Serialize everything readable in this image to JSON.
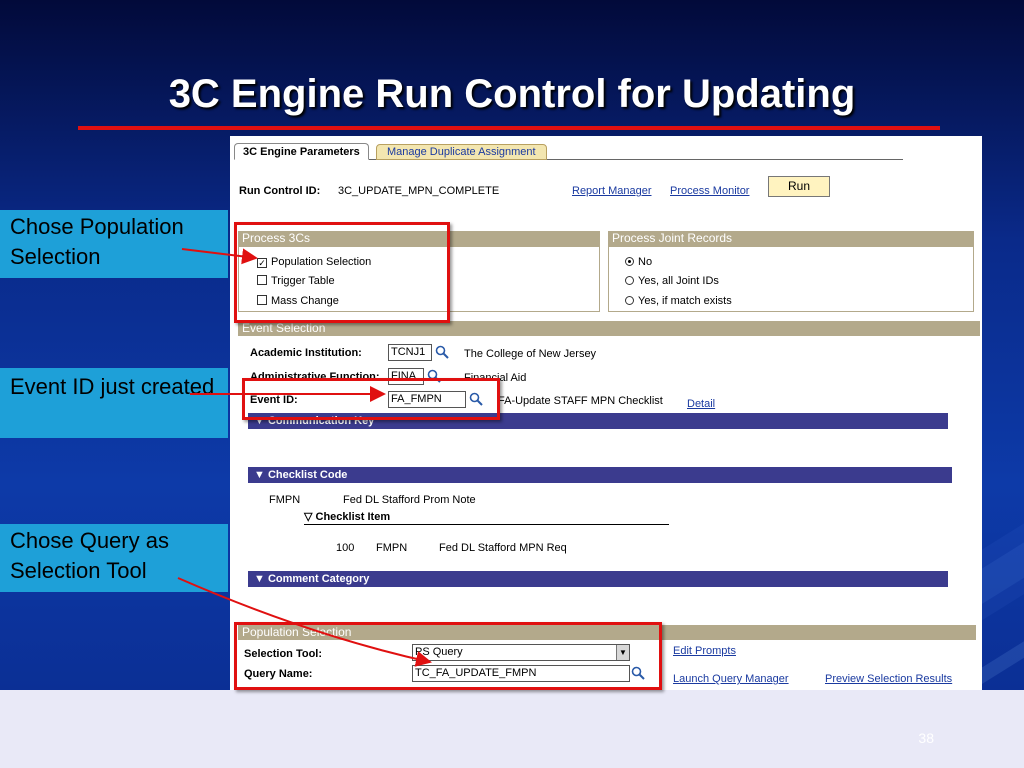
{
  "slide": {
    "title": "3C Engine Run Control for Updating",
    "page_number": "38"
  },
  "callouts": [
    {
      "text": "Chose Population Selection"
    },
    {
      "text": "Event ID just created"
    },
    {
      "text": "Chose Query as Selection Tool"
    }
  ],
  "tabs": {
    "active": "3C Engine Parameters",
    "inactive": "Manage Duplicate Assignment"
  },
  "run_control": {
    "label": "Run Control ID:",
    "value": "3C_UPDATE_MPN_COMPLETE",
    "report_manager": "Report Manager",
    "process_monitor": "Process Monitor",
    "run_button": "Run"
  },
  "process_3cs": {
    "title": "Process 3Cs",
    "options": [
      {
        "label": "Population Selection",
        "checked": true
      },
      {
        "label": "Trigger Table",
        "checked": false
      },
      {
        "label": "Mass Change",
        "checked": false
      }
    ]
  },
  "process_joint": {
    "title": "Process Joint Records",
    "options": [
      {
        "label": "No",
        "selected": true
      },
      {
        "label": "Yes, all Joint IDs",
        "selected": false
      },
      {
        "label": "Yes, if match exists",
        "selected": false
      }
    ]
  },
  "event_selection": {
    "title": "Event Selection",
    "academic_institution_label": "Academic Institution:",
    "academic_institution_value": "TCNJ1",
    "academic_institution_desc": "The College of New Jersey",
    "admin_function_label": "Administrative Function:",
    "admin_function_value": "FINA",
    "admin_function_desc": "Financial Aid",
    "event_id_label": "Event ID:",
    "event_id_value": "FA_FMPN",
    "event_id_desc": "FA-Update STAFF MPN Checklist",
    "detail_link": "Detail"
  },
  "communication_key": {
    "title": "Communication Key"
  },
  "checklist_code": {
    "title": "Checklist Code",
    "code": "FMPN",
    "desc": "Fed DL Stafford Prom Note",
    "item_title": "Checklist Item",
    "item_seq": "100",
    "item_code": "FMPN",
    "item_desc": "Fed DL Stafford  MPN Req"
  },
  "comment_category": {
    "title": "Comment Category"
  },
  "population_selection": {
    "title": "Population Selection",
    "selection_tool_label": "Selection Tool:",
    "selection_tool_value": "PS Query",
    "query_name_label": "Query Name:",
    "query_name_value": "TC_FA_UPDATE_FMPN",
    "edit_prompts": "Edit Prompts",
    "launch_query_manager": "Launch Query Manager",
    "preview_results": "Preview Selection Results"
  },
  "colors": {
    "callout_bg": "#1ea0d8",
    "highlight_red": "#e01010",
    "section_header": "#b3a98b",
    "bar_navy": "#3b3b8e",
    "link": "#1a3aa0"
  }
}
